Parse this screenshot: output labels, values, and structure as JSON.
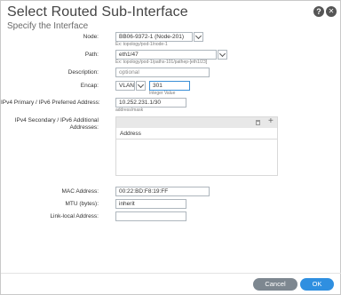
{
  "dialog": {
    "title": "Select Routed Sub-Interface",
    "subtitle": "Specify the Interface",
    "help_icon": "?",
    "close_icon": "✕"
  },
  "form": {
    "node": {
      "label": "Node:",
      "value": "BB06-9372-1 (Node-201)",
      "hint": "Ex: topology/pod-1/node-1"
    },
    "path": {
      "label": "Path:",
      "value": "eth1/47",
      "hint": "Ex: topology/pod-1/paths-101/pathep-[eth1/23]"
    },
    "description": {
      "label": "Description:",
      "placeholder": "optional"
    },
    "encap": {
      "label": "Encap:",
      "type_value": "VLAN",
      "value": "301",
      "hint": "Integer Value"
    },
    "ipv4_primary": {
      "label": "IPv4 Primary / IPv6 Preferred Address:",
      "value": "10.252.231.1/30",
      "hint": "address/mask"
    },
    "ipv4_secondary": {
      "label_line1": "IPv4 Secondary / IPv6 Additional",
      "label_line2": "Addresses:",
      "column_header": "Address"
    },
    "mac": {
      "label": "MAC Address:",
      "value": "00:22:BD:F8:19:FF"
    },
    "mtu": {
      "label": "MTU (bytes):",
      "value": "inherit"
    },
    "link_local": {
      "label": "Link-local Address:",
      "value": ""
    }
  },
  "buttons": {
    "cancel": "Cancel",
    "ok": "OK"
  }
}
